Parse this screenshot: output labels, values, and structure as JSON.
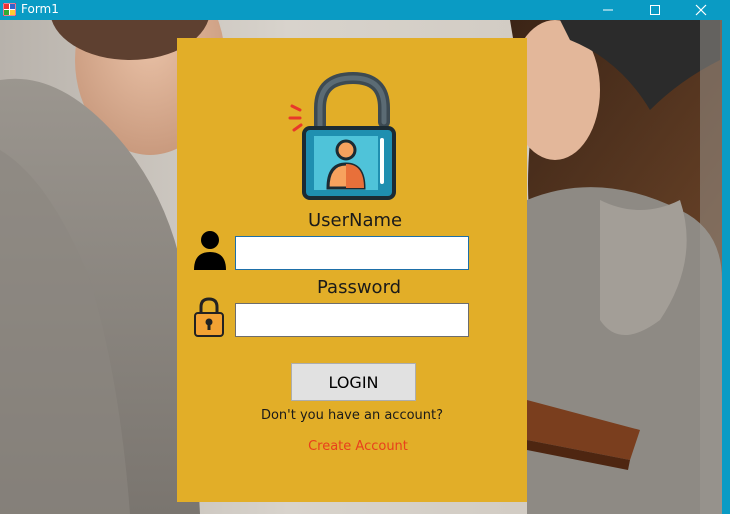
{
  "window": {
    "title": "Form1",
    "icon": "winforms-app-icon",
    "controls": [
      "minimize-icon",
      "maximize-icon",
      "close-icon"
    ]
  },
  "colors": {
    "titlebar": "#0a9bc4",
    "panel": "#e2ae28",
    "link": "#e8401c"
  },
  "login": {
    "logo": "lock-user-icon",
    "username_label": "UserName",
    "username_value": "",
    "password_label": "Password",
    "password_value": "",
    "user_icon": "person-icon",
    "password_icon": "padlock-icon",
    "login_button": "LOGIN",
    "account_prompt": "Don't you have an account?",
    "create_account_link": "Create Account"
  }
}
